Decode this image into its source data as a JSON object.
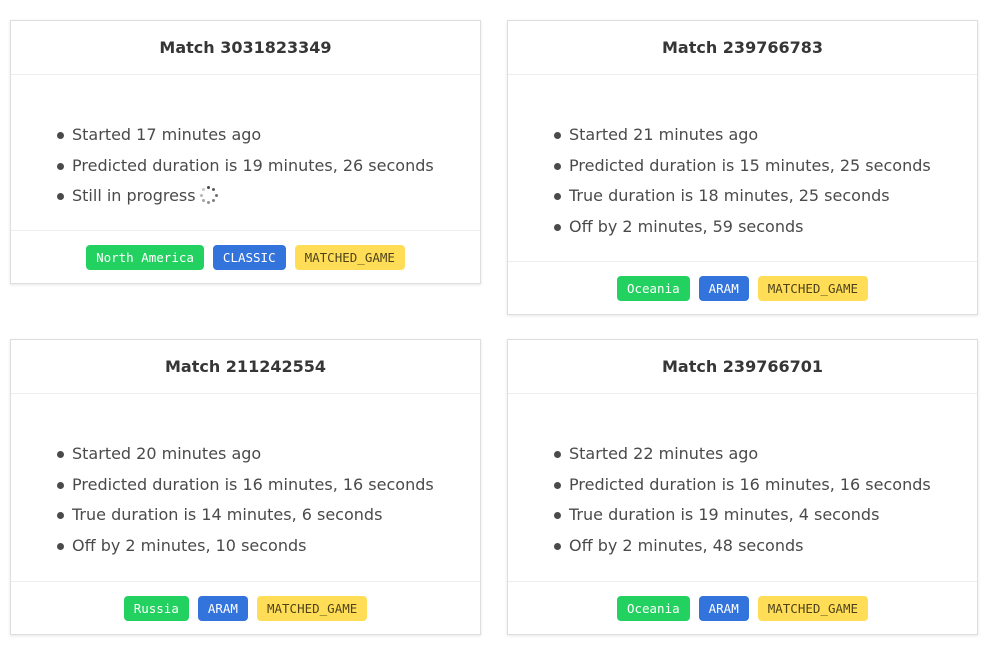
{
  "cards": [
    {
      "title": "Match 3031823349",
      "items": [
        "Started 17 minutes ago",
        "Predicted duration is 19 minutes, 26 seconds",
        "Still in progress"
      ],
      "loading_icon": "spinner-icon",
      "tags": {
        "region": "North America",
        "mode": "CLASSIC",
        "type": "MATCHED_GAME"
      }
    },
    {
      "title": "Match 239766783",
      "items": [
        "Started 21 minutes ago",
        "Predicted duration is 15 minutes, 25 seconds",
        "True duration is 18 minutes, 25 seconds",
        "Off by 2 minutes, 59 seconds"
      ],
      "tags": {
        "region": "Oceania",
        "mode": "ARAM",
        "type": "MATCHED_GAME"
      }
    },
    {
      "title": "Match 211242554",
      "items": [
        "Started 20 minutes ago",
        "Predicted duration is 16 minutes, 16 seconds",
        "True duration is 14 minutes, 6 seconds",
        "Off by 2 minutes, 10 seconds"
      ],
      "tags": {
        "region": "Russia",
        "mode": "ARAM",
        "type": "MATCHED_GAME"
      }
    },
    {
      "title": "Match 239766701",
      "items": [
        "Started 22 minutes ago",
        "Predicted duration is 16 minutes, 16 seconds",
        "True duration is 19 minutes, 4 seconds",
        "Off by 2 minutes, 48 seconds"
      ],
      "tags": {
        "region": "Oceania",
        "mode": "ARAM",
        "type": "MATCHED_GAME"
      }
    }
  ],
  "colors": {
    "region_tag": "#23d160",
    "mode_tag": "#3273dc",
    "type_tag": "#ffdd57"
  }
}
